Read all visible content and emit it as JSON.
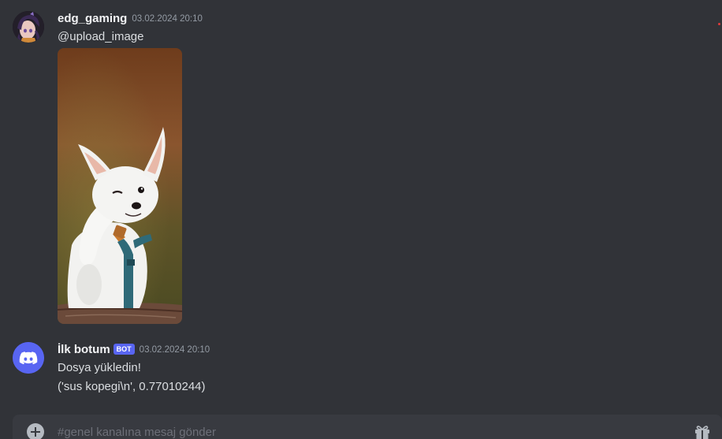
{
  "messages": [
    {
      "username": "edg_gaming",
      "timestamp": "03.02.2024 20:10",
      "text": "@upload_image",
      "attachment": {
        "kind": "image",
        "subject": "white chihuahua dog photo"
      },
      "avatar_icon": "user-avatar"
    },
    {
      "username": "İlk botum",
      "badge": "BOT",
      "timestamp": "03.02.2024 20:10",
      "lines": [
        "Dosya yükledin!",
        "('sus kopegi\\n', 0.77010244)"
      ],
      "avatar_icon": "discord-logo-icon"
    }
  ],
  "composer": {
    "placeholder": "#genel kanalına mesaj gönder",
    "value": "",
    "add_icon": "plus-circle-icon",
    "gift_icon": "gift-icon"
  },
  "colors": {
    "background": "#313338",
    "composer": "#383a40",
    "blurple": "#5865f2",
    "text": "#dbdee1",
    "timestamp": "#949ba4"
  }
}
